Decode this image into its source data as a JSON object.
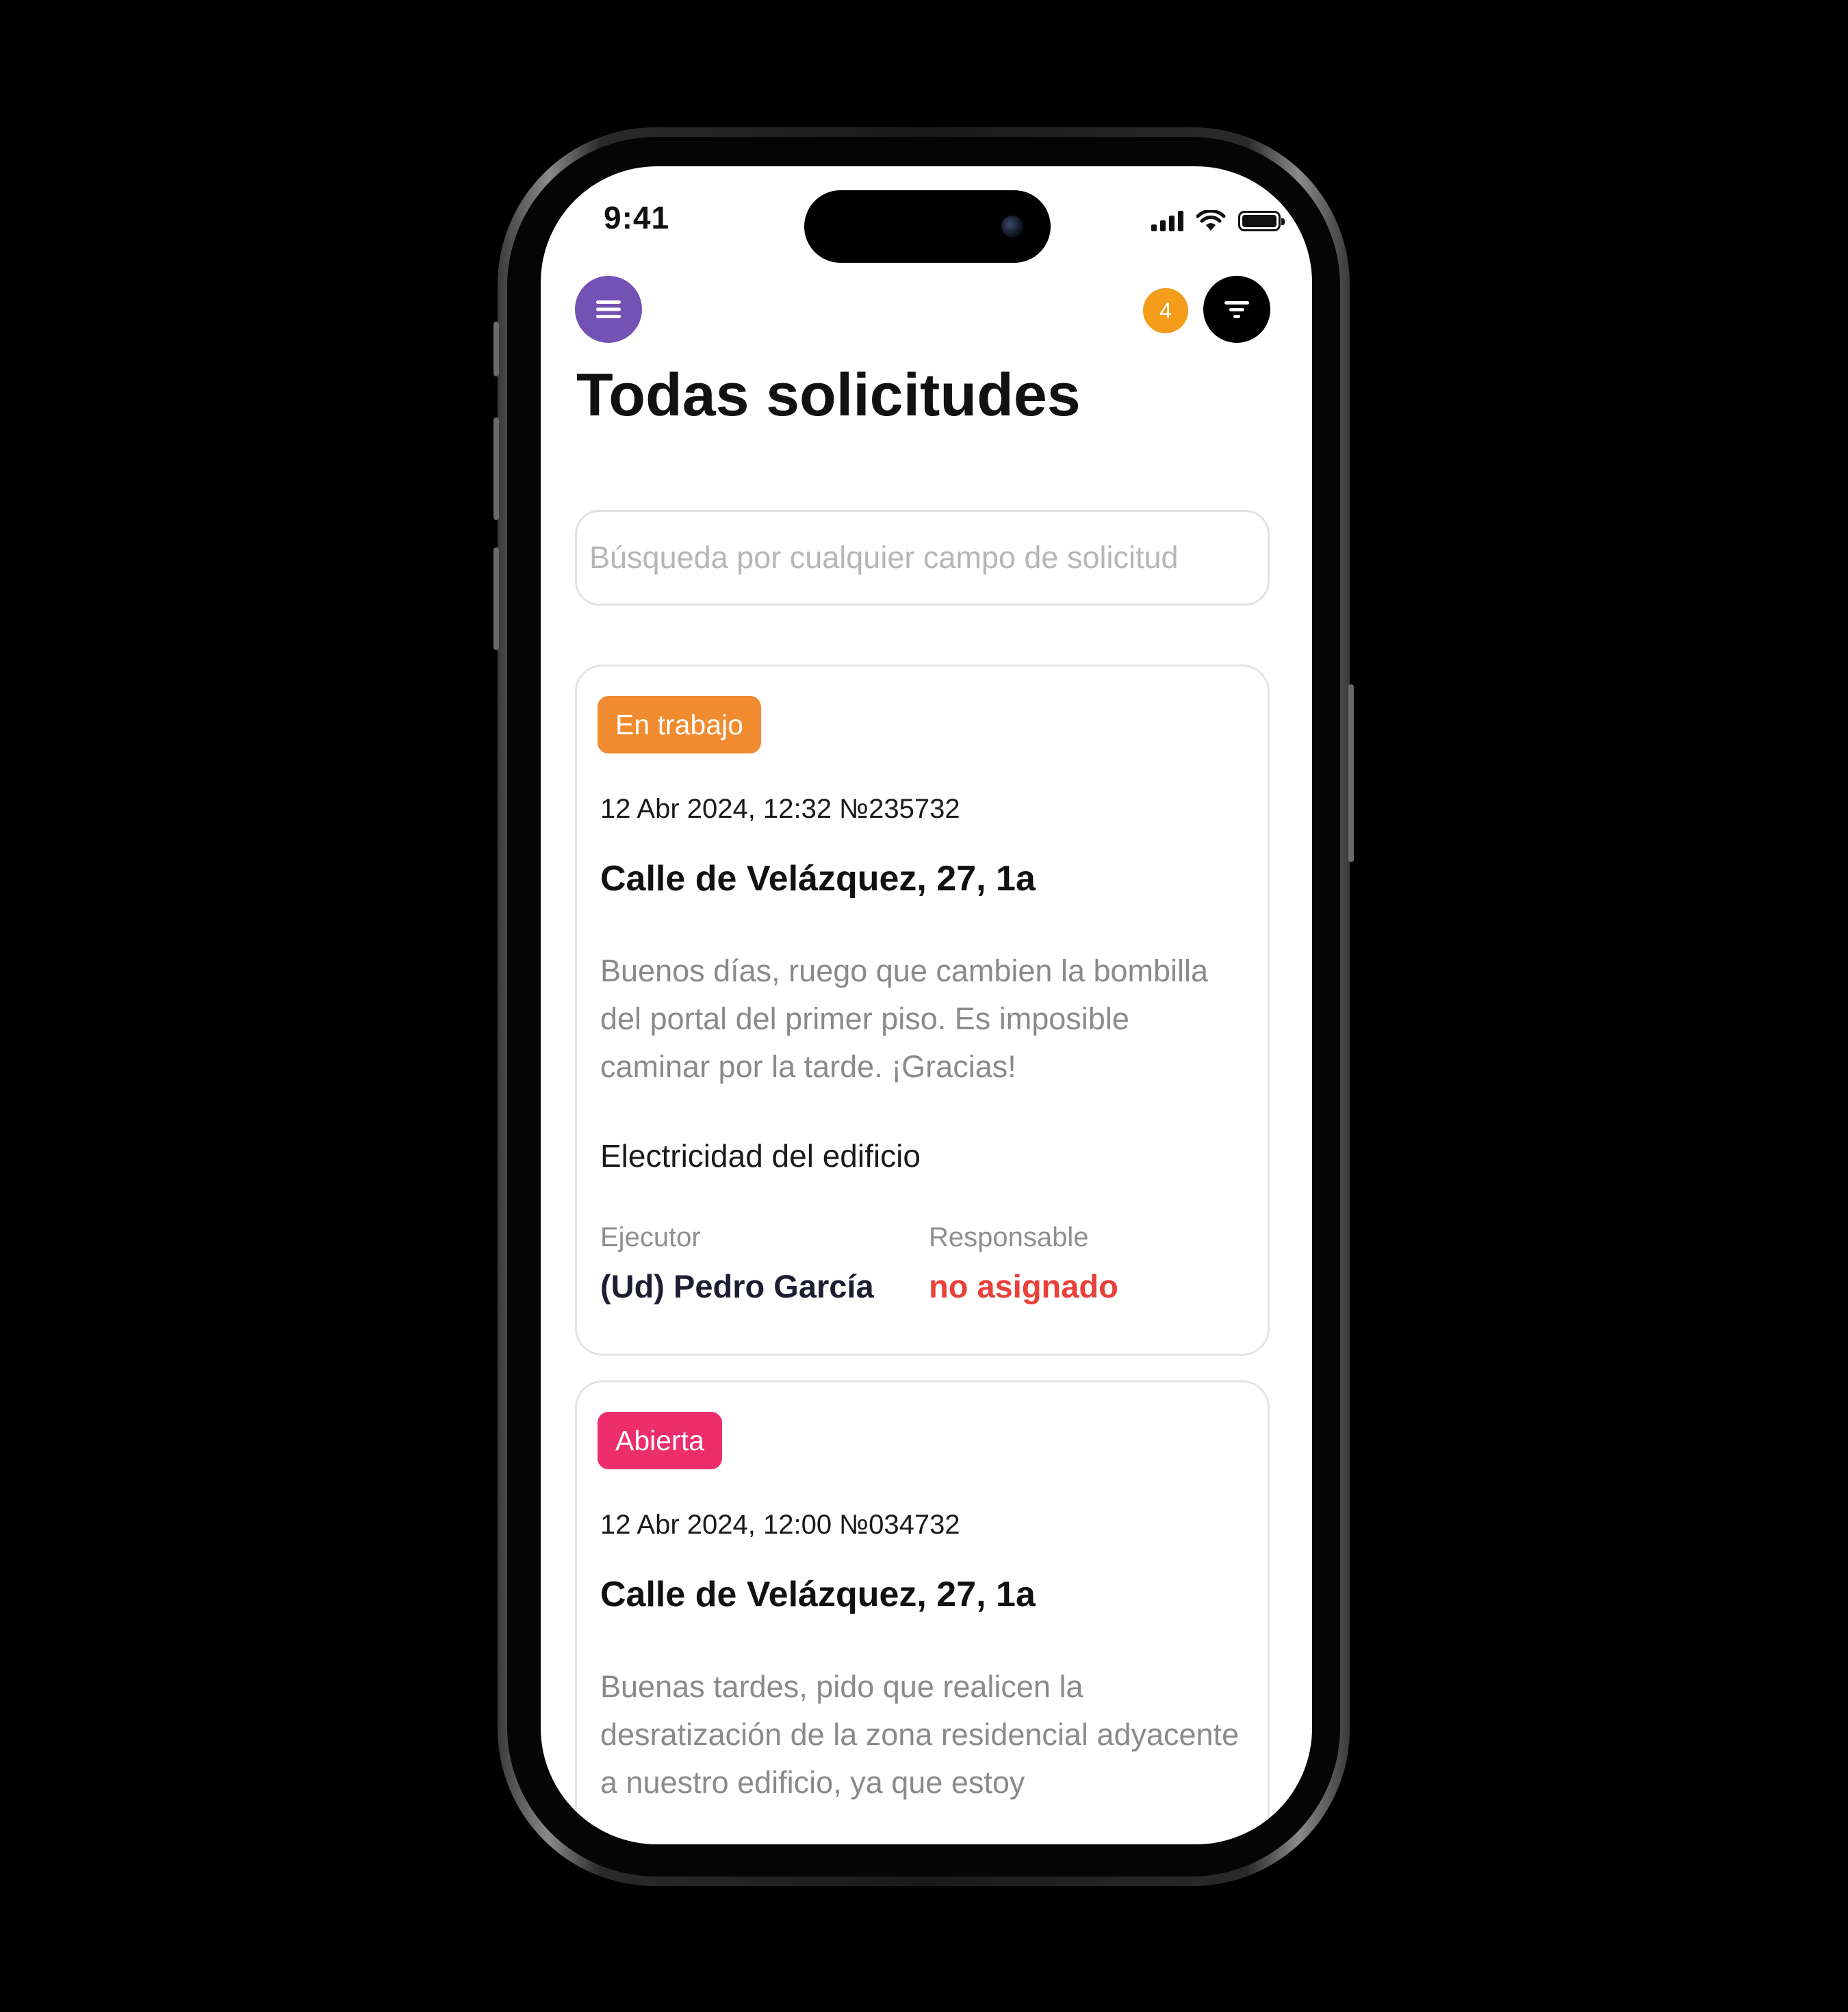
{
  "status_bar": {
    "time": "9:41"
  },
  "header": {
    "menu_icon": "hamburger-menu-icon",
    "filter_count": "4",
    "filter_icon": "filter-funnel-icon",
    "title": "Todas solicitudes"
  },
  "search": {
    "placeholder": "Búsqueda por cualquier campo de solicitud",
    "value": ""
  },
  "requests": [
    {
      "status": "En trabajo",
      "status_color": "#f18b2f",
      "meta": "12 Abr 2024, 12:32 №235732",
      "address": "Calle de Velázquez, 27, 1a",
      "description": "Buenos días, ruego que cambien la bombilla del portal del primer piso. Es imposible caminar por la tarde. ¡Gracias!",
      "category": "Electricidad del edificio",
      "executor_label": "Ejecutor",
      "executor_value": "(Ud) Pedro García",
      "responsible_label": "Responsable",
      "responsible_value": "no asignado"
    },
    {
      "status": "Abierta",
      "status_color": "#ec2f6c",
      "meta": "12 Abr 2024, 12:00 №034732",
      "address": "Calle de Velázquez, 27, 1a",
      "description": "Buenas tardes, pido que realicen la desratización de la zona residencial adyacente a nuestro edificio, ya que estoy"
    }
  ],
  "colors": {
    "menu_button": "#7452b3",
    "badge": "#f59c1a",
    "unassigned": "#e8413a",
    "executor_text": "#1e1e33"
  }
}
